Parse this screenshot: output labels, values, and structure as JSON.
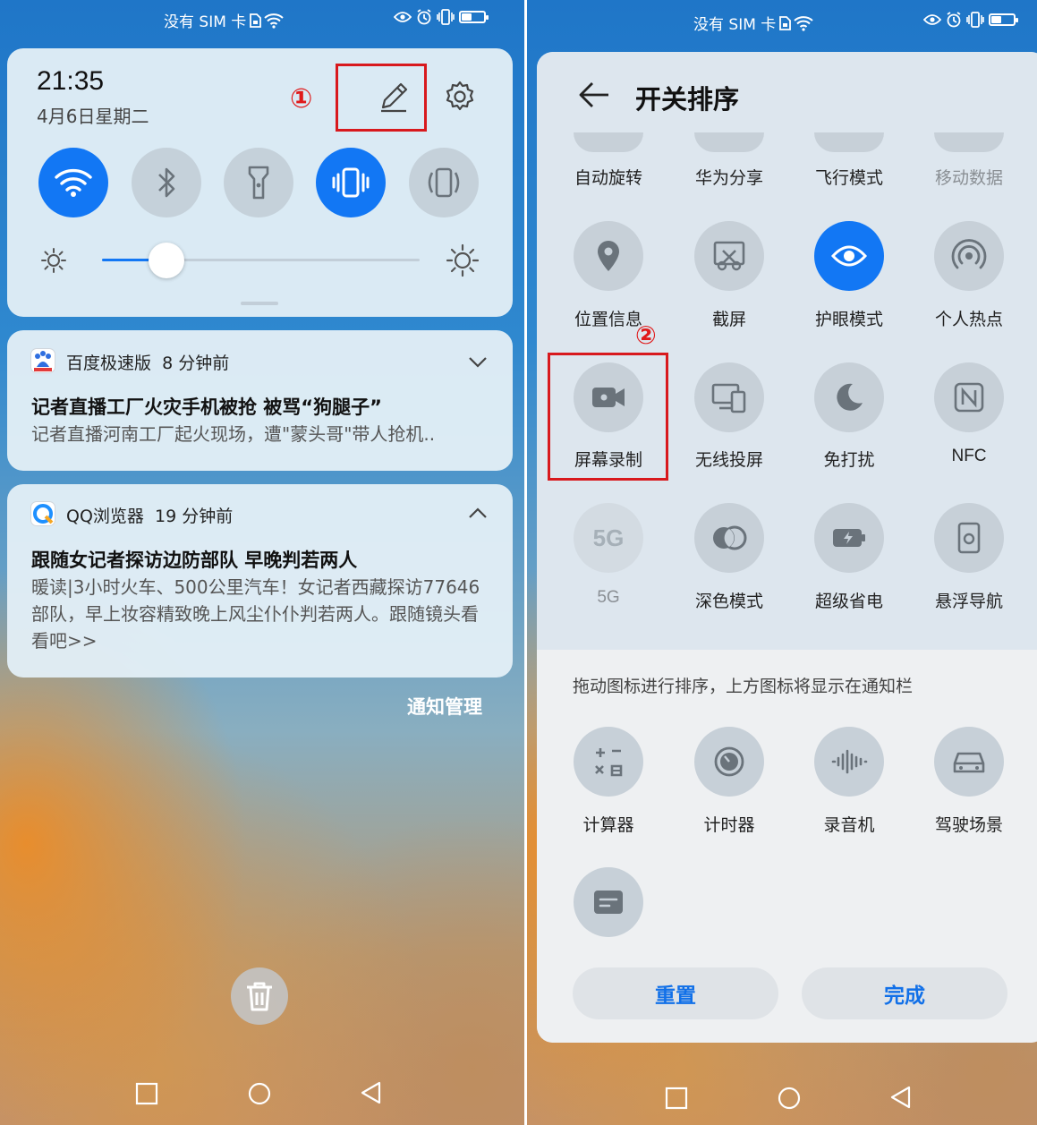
{
  "left": {
    "statusbar": {
      "carrier": "没有 SIM 卡"
    },
    "quick_settings": {
      "time": "21:35",
      "date": "4月6日星期二",
      "marker": "①",
      "toggles": [
        {
          "icon": "wifi-icon",
          "state": "on"
        },
        {
          "icon": "bluetooth-icon",
          "state": "off"
        },
        {
          "icon": "flashlight-icon",
          "state": "off"
        },
        {
          "icon": "vibrate-icon",
          "state": "on"
        },
        {
          "icon": "auto-rotate-icon",
          "state": "off"
        }
      ],
      "brightness": 0.2
    },
    "notifications": [
      {
        "app": "百度极速版",
        "time": "8 分钟前",
        "title": "记者直播工厂火灾手机被抢 被骂“狗腿子”",
        "body": "记者直播河南工厂起火现场，遭\"蒙头哥\"带人抢机.."
      },
      {
        "app": "QQ浏览器",
        "time": "19 分钟前",
        "title": "跟随女记者探访边防部队 早晚判若两人",
        "body": "暖读|3小时火车、500公里汽车！女记者西藏探访77646部队，早上妆容精致晚上风尘仆仆判若两人。跟随镜头看看吧>>"
      }
    ],
    "notif_manage": "通知管理"
  },
  "right": {
    "statusbar": {
      "carrier": "没有 SIM 卡"
    },
    "title": "开关排序",
    "marker": "②",
    "tiles_row1": [
      "自动旋转",
      "华为分享",
      "飞行模式",
      "移动数据"
    ],
    "tiles_row2": [
      "位置信息",
      "截屏",
      "护眼模式",
      "个人热点"
    ],
    "tiles_row3": [
      "屏幕录制",
      "无线投屏",
      "免打扰",
      "NFC"
    ],
    "tiles_row4": [
      "5G",
      "深色模式",
      "超级省电",
      "悬浮导航"
    ],
    "fiveg_text": "5G",
    "hint": "拖动图标进行排序，上方图标将显示在通知栏",
    "extra_tiles": [
      "计算器",
      "计时器",
      "录音机",
      "驾驶场景"
    ],
    "reset": "重置",
    "done": "完成"
  },
  "colors": {
    "accent": "#1277f4",
    "highlight": "#d8191d"
  }
}
